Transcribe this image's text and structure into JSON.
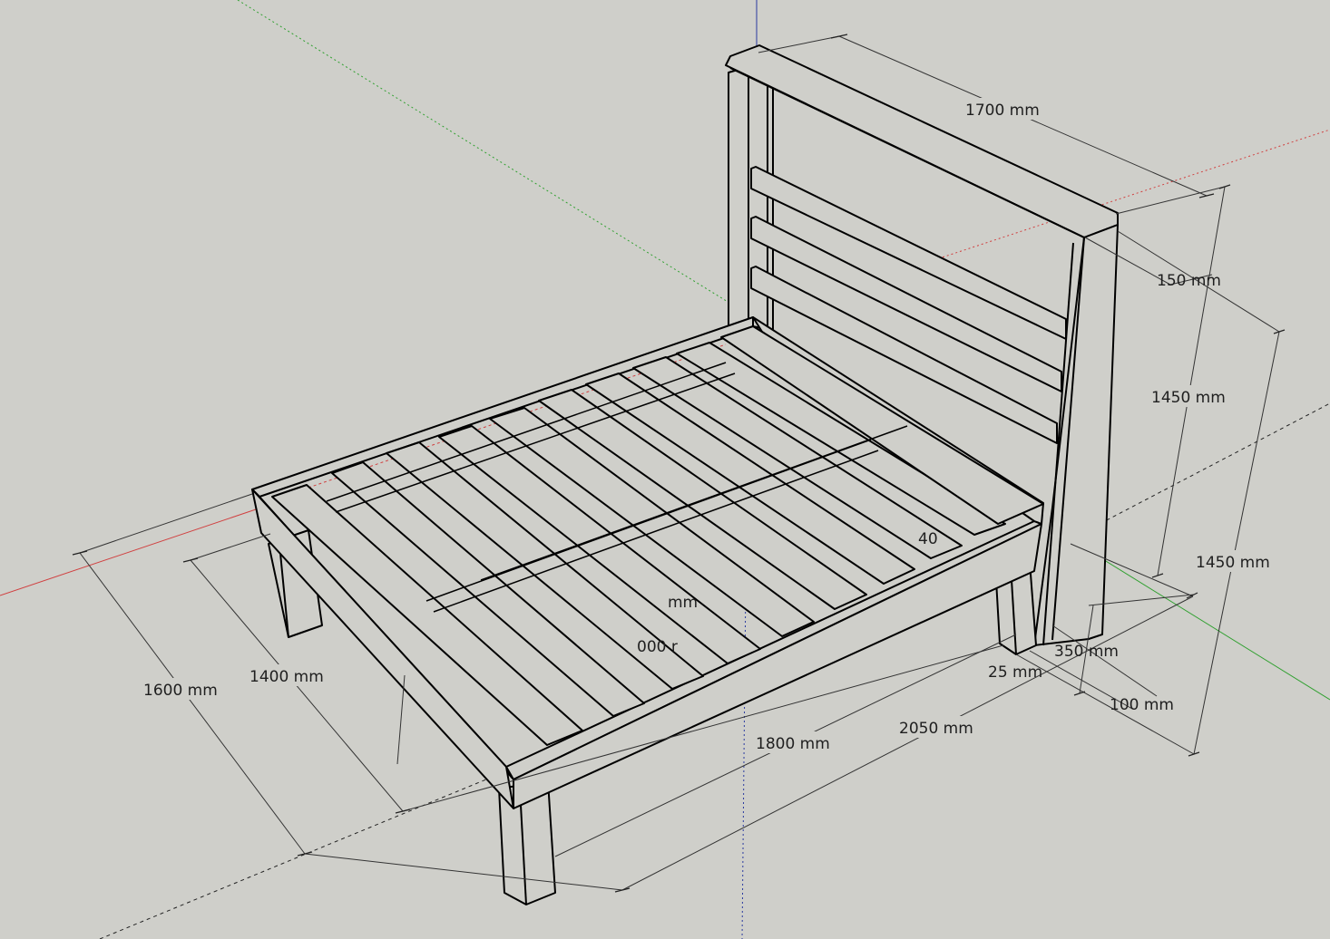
{
  "scene": {
    "background_color": "#cfcfca",
    "model_fill_color": "#cfcfca",
    "edge_color": "#000000",
    "axis_colors": {
      "red": "#d04040",
      "green": "#30a030",
      "blue": "#2a3aa0"
    }
  },
  "dimensions": {
    "headboard_width": "1700 mm",
    "headboard_rail": "150 mm",
    "headboard_height_inner": "1450 mm",
    "headboard_height_outer": "1450 mm",
    "frame_width_outer": "1600 mm",
    "frame_width_inner": "1400 mm",
    "frame_length_inner": "1800 mm",
    "frame_length_outer": "2050 mm",
    "leg_depth": "350 mm",
    "board_thickness": "25 mm",
    "post_width": "100 mm",
    "partial_a": "40",
    "partial_b": "mm",
    "partial_c": "000 r"
  }
}
